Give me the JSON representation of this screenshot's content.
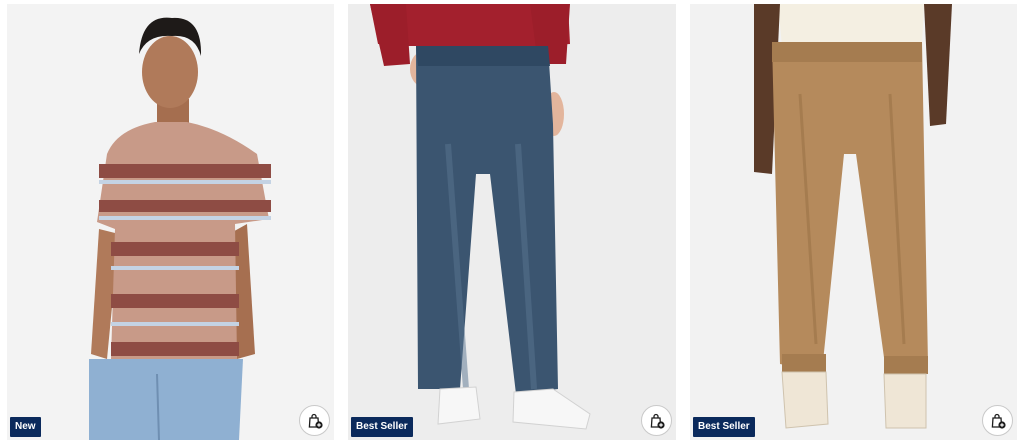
{
  "products": [
    {
      "badge": "New",
      "image_icon": "striped-tshirt-model-photo",
      "action_icon": "add-to-bag-icon"
    },
    {
      "badge": "Best Seller",
      "image_icon": "straight-jeans-model-photo",
      "action_icon": "add-to-bag-icon"
    },
    {
      "badge": "Best Seller",
      "image_icon": "khaki-joggers-model-photo",
      "action_icon": "add-to-bag-icon"
    }
  ],
  "colors": {
    "badge_background": "#0b2a5c",
    "badge_text": "#ffffff",
    "card_background": "#f1f1f1"
  }
}
